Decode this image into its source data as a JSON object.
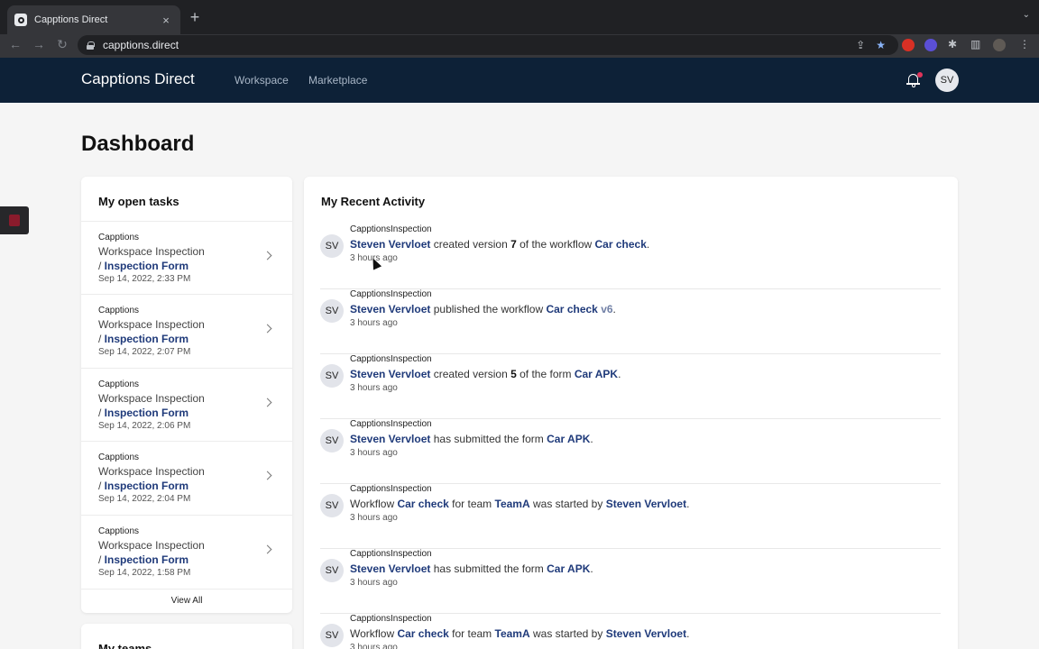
{
  "browser": {
    "tab_title": "Capptions Direct",
    "tab_close": "×",
    "new_tab": "+",
    "tab_list": "⌄",
    "back": "←",
    "forward": "→",
    "reload": "↻",
    "url": "capptions.direct",
    "share_icon": "⇪",
    "star_icon": "★",
    "extensions_icon": "✱",
    "sidebar_icon": "▥",
    "menu_icon": "⋮"
  },
  "header": {
    "brand": "Capptions Direct",
    "nav": [
      "Workspace",
      "Marketplace"
    ],
    "avatar": "SV"
  },
  "page": {
    "title": "Dashboard"
  },
  "tasks": {
    "title": "My open tasks",
    "items": [
      {
        "org": "Capptions",
        "name": "Workspace Inspection",
        "sep": "/ ",
        "form": "Inspection Form",
        "date": "Sep 14, 2022, 2:33 PM"
      },
      {
        "org": "Capptions",
        "name": "Workspace Inspection",
        "sep": "/ ",
        "form": "Inspection Form",
        "date": "Sep 14, 2022, 2:07 PM"
      },
      {
        "org": "Capptions",
        "name": "Workspace Inspection",
        "sep": "/ ",
        "form": "Inspection Form",
        "date": "Sep 14, 2022, 2:06 PM"
      },
      {
        "org": "Capptions",
        "name": "Workspace Inspection",
        "sep": "/ ",
        "form": "Inspection Form",
        "date": "Sep 14, 2022, 2:04 PM"
      },
      {
        "org": "Capptions",
        "name": "Workspace Inspection",
        "sep": "/ ",
        "form": "Inspection Form",
        "date": "Sep 14, 2022, 1:58 PM"
      }
    ],
    "view_all": "View All"
  },
  "teams": {
    "title": "My teams"
  },
  "activity": {
    "title": "My Recent Activity",
    "items": [
      {
        "avatar": "SV",
        "source": "CapptionsInspection",
        "time": "3 hours ago",
        "parts": [
          [
            "lnk",
            "Steven Vervloet"
          ],
          [
            "t",
            " created version "
          ],
          [
            "num",
            "7"
          ],
          [
            "t",
            " of the workflow "
          ],
          [
            "lnk",
            "Car check"
          ],
          [
            "t",
            "."
          ]
        ]
      },
      {
        "avatar": "SV",
        "source": "CapptionsInspection",
        "time": "3 hours ago",
        "parts": [
          [
            "lnk",
            "Steven Vervloet"
          ],
          [
            "t",
            " published the workflow "
          ],
          [
            "lnk",
            "Car check"
          ],
          [
            "t",
            " "
          ],
          [
            "lnk-soft",
            "v6"
          ],
          [
            "t",
            "."
          ]
        ]
      },
      {
        "avatar": "SV",
        "source": "CapptionsInspection",
        "time": "3 hours ago",
        "parts": [
          [
            "lnk",
            "Steven Vervloet"
          ],
          [
            "t",
            " created version "
          ],
          [
            "num",
            "5"
          ],
          [
            "t",
            " of the form "
          ],
          [
            "lnk",
            "Car APK"
          ],
          [
            "t",
            "."
          ]
        ]
      },
      {
        "avatar": "SV",
        "source": "CapptionsInspection",
        "time": "3 hours ago",
        "parts": [
          [
            "lnk",
            "Steven Vervloet"
          ],
          [
            "t",
            " has submitted the form "
          ],
          [
            "lnk",
            "Car APK"
          ],
          [
            "t",
            "."
          ]
        ]
      },
      {
        "avatar": "SV",
        "source": "CapptionsInspection",
        "time": "3 hours ago",
        "parts": [
          [
            "t",
            "Workflow "
          ],
          [
            "lnk",
            "Car check"
          ],
          [
            "t",
            " for team "
          ],
          [
            "lnk",
            "TeamA"
          ],
          [
            "t",
            " was started by "
          ],
          [
            "lnk",
            "Steven Vervloet"
          ],
          [
            "t",
            "."
          ]
        ]
      },
      {
        "avatar": "SV",
        "source": "CapptionsInspection",
        "time": "3 hours ago",
        "parts": [
          [
            "lnk",
            "Steven Vervloet"
          ],
          [
            "t",
            " has submitted the form "
          ],
          [
            "lnk",
            "Car APK"
          ],
          [
            "t",
            "."
          ]
        ]
      },
      {
        "avatar": "SV",
        "source": "CapptionsInspection",
        "time": "3 hours ago",
        "parts": [
          [
            "t",
            "Workflow "
          ],
          [
            "lnk",
            "Car check"
          ],
          [
            "t",
            " for team "
          ],
          [
            "lnk",
            "TeamA"
          ],
          [
            "t",
            " was started by "
          ],
          [
            "lnk",
            "Steven Vervloet"
          ],
          [
            "t",
            "."
          ]
        ]
      }
    ]
  },
  "colors": {
    "header_bg": "#0d2137",
    "link": "#1f3a7a",
    "notification_dot": "#e0345a",
    "page_bg": "#f5f5f5"
  }
}
